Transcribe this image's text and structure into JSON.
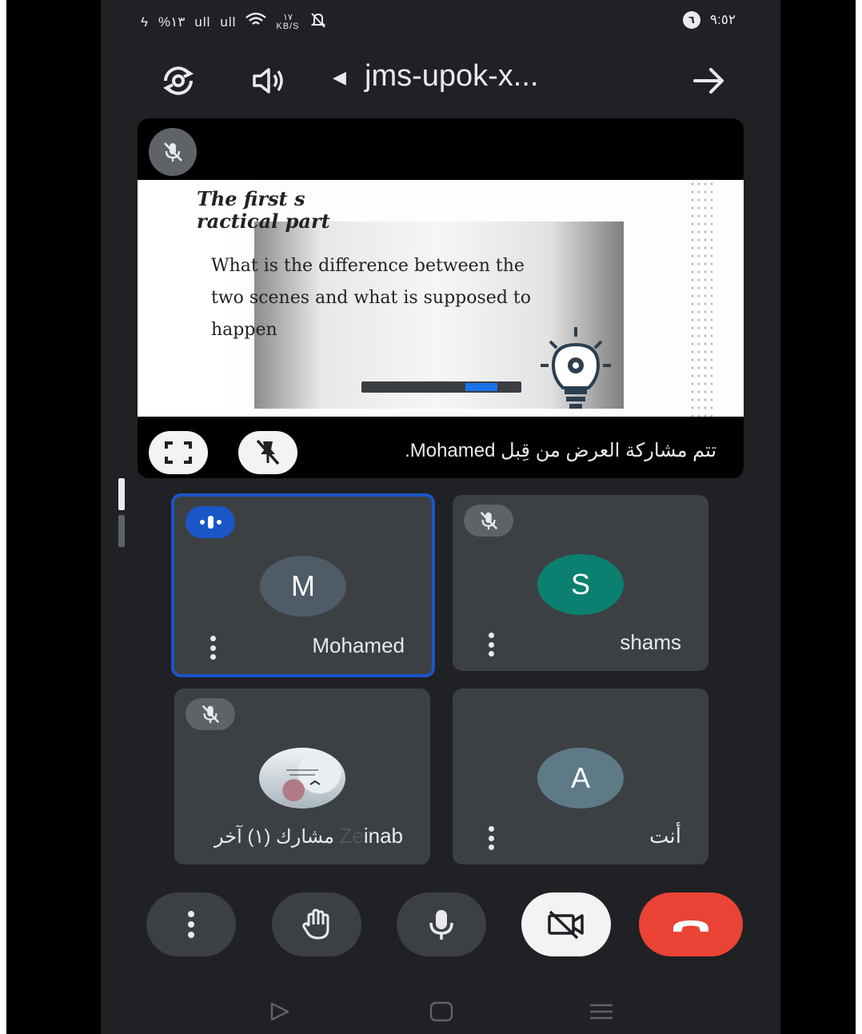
{
  "status_bar": {
    "battery": "%١٣",
    "signal_1": "ull",
    "signal_2": "ull",
    "net_speed_value": "١٧",
    "net_speed_unit": "KB/S",
    "notification_count": "٦",
    "time": "٩:٥٢"
  },
  "top_bar": {
    "meeting_code": "jms-upok-x..."
  },
  "presentation": {
    "slide_heading_line1": "The first s",
    "slide_heading_line2": "ractical part",
    "slide_body_line1": "What is the difference between the",
    "slide_body_line2": "two scenes and what is supposed to",
    "slide_body_line3": "happen",
    "shared_by_text": "تتم مشاركة العرض من قِبل Mohamed."
  },
  "participants": [
    {
      "name": "Mohamed",
      "initial": "M",
      "avatar_color": "#4f5b66",
      "state": "speaking"
    },
    {
      "name": "shams",
      "initial": "S",
      "avatar_color": "#0b8070",
      "state": "muted"
    },
    {
      "name": "Zeinab",
      "initial": "",
      "avatar_color": "#cfd6db",
      "state": "muted"
    },
    {
      "name": "أنت",
      "initial": "A",
      "avatar_color": "#5f7a87",
      "state": "self"
    }
  ],
  "others_chip": "مشارك (١) آخر",
  "colors": {
    "screen_bg": "#202124",
    "tile_bg": "#3c4043",
    "active_border": "#1a56c6",
    "end_call": "#ea4335"
  },
  "controls": [
    "more-options",
    "raise-hand",
    "microphone",
    "camera-off",
    "end-call"
  ]
}
